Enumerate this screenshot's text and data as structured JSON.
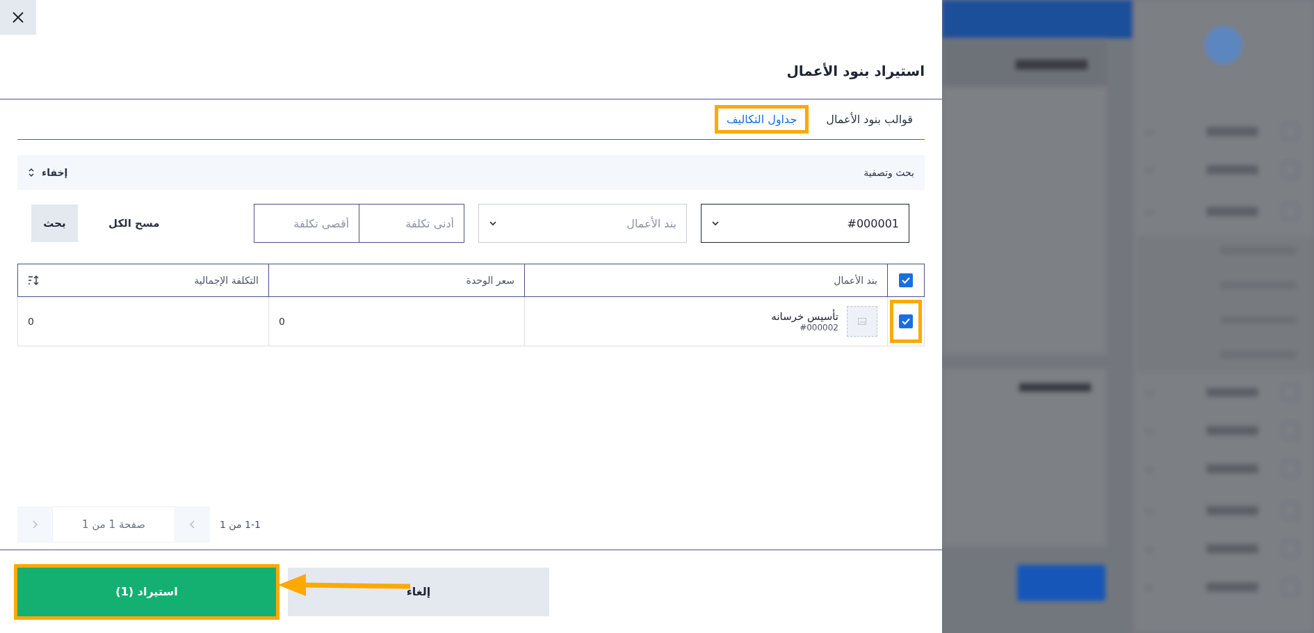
{
  "title": "استيراد بنود الأعمال",
  "tabs": [
    {
      "label": "قوالب بنود الأعمال",
      "selected": false,
      "highlighted": false
    },
    {
      "label": "جداول التكاليف",
      "selected": true,
      "highlighted": true
    }
  ],
  "filter_panel": {
    "title": "بحث وتصفية",
    "toggle": "إخفاء",
    "expanded": true
  },
  "filters": [
    {
      "kind": "select",
      "value": "#000001"
    },
    {
      "kind": "select",
      "placeholder": "بند الأعمال"
    },
    {
      "kind": "range",
      "placeholders": [
        "أدنى تكلفة",
        "أقصى تكلفة"
      ]
    }
  ],
  "clear_all": "مسح الكل",
  "search_button": "بحث",
  "table": {
    "all_checked": true,
    "columns": [
      "بند الأعمال",
      "سعر الوحدة",
      "التكلفة الإجمالية"
    ],
    "rows": [
      {
        "checked": true,
        "highlighted": true,
        "name": "تأسيس خرسانه",
        "code": "#000002",
        "unit_price": "0",
        "total": "0"
      }
    ]
  },
  "pagination": {
    "summary": "1-1 من 1",
    "page": "صفحة 1 من 1"
  },
  "footer": {
    "import_button": {
      "label": "استيراد (1)",
      "highlighted": true
    },
    "cancel_button": {
      "label": "إلغاء"
    },
    "arrow": true
  }
}
